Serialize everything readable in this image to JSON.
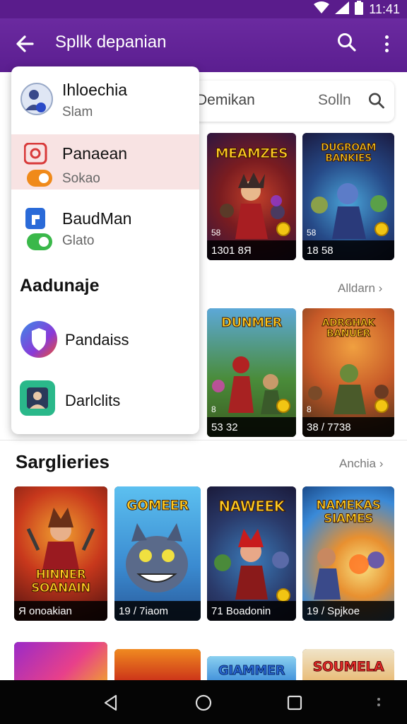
{
  "status": {
    "time": "11:41"
  },
  "app_bar": {
    "title": "Spllk depanian"
  },
  "search": {
    "text": "Demikan",
    "hint": "Solln"
  },
  "drawer": {
    "accounts": [
      {
        "title": "Ihloechia",
        "subtitle": "Slam"
      },
      {
        "title": "Panaean",
        "subtitle": "Sokao"
      },
      {
        "title": "BaudMan",
        "subtitle": "Glato"
      }
    ],
    "heading": "Aadunaje",
    "apps": [
      {
        "label": "Pandaiss"
      },
      {
        "label": "Darlclits"
      }
    ]
  },
  "section1": {
    "action": "Alldarn",
    "tiles": [
      {
        "title": "MEAMZES",
        "meta": "1301 8Я",
        "sub": "58"
      },
      {
        "title": "DUGROAM BANKIES",
        "meta": "18 58",
        "sub": "58"
      },
      {
        "title": "DUNMER",
        "meta": "53 32",
        "sub": "8"
      },
      {
        "title": "ADRGHAK BANUER",
        "meta": "38 / 7738",
        "sub": "8"
      }
    ]
  },
  "section2": {
    "title": "Sarglieries",
    "action": "Anchia",
    "tiles": [
      {
        "title": "HINNER SOANAIN",
        "meta": "Я onoakian"
      },
      {
        "title": "GOMEER",
        "meta": "19 / 7iaom"
      },
      {
        "title": "NAWEEK",
        "meta": "71 Boadonin"
      },
      {
        "title": "NAMEKAS SIAMES",
        "meta": "19 / Spjkoe"
      }
    ]
  },
  "section3": {
    "tiles": [
      {
        "title": ""
      },
      {
        "title": ""
      },
      {
        "title": "GIAMMER"
      },
      {
        "title": "SOUMELA"
      }
    ]
  },
  "colors": {
    "primary": "#5a1c8c",
    "highlight": "#f8e3e3",
    "badge": "#f2c513"
  }
}
